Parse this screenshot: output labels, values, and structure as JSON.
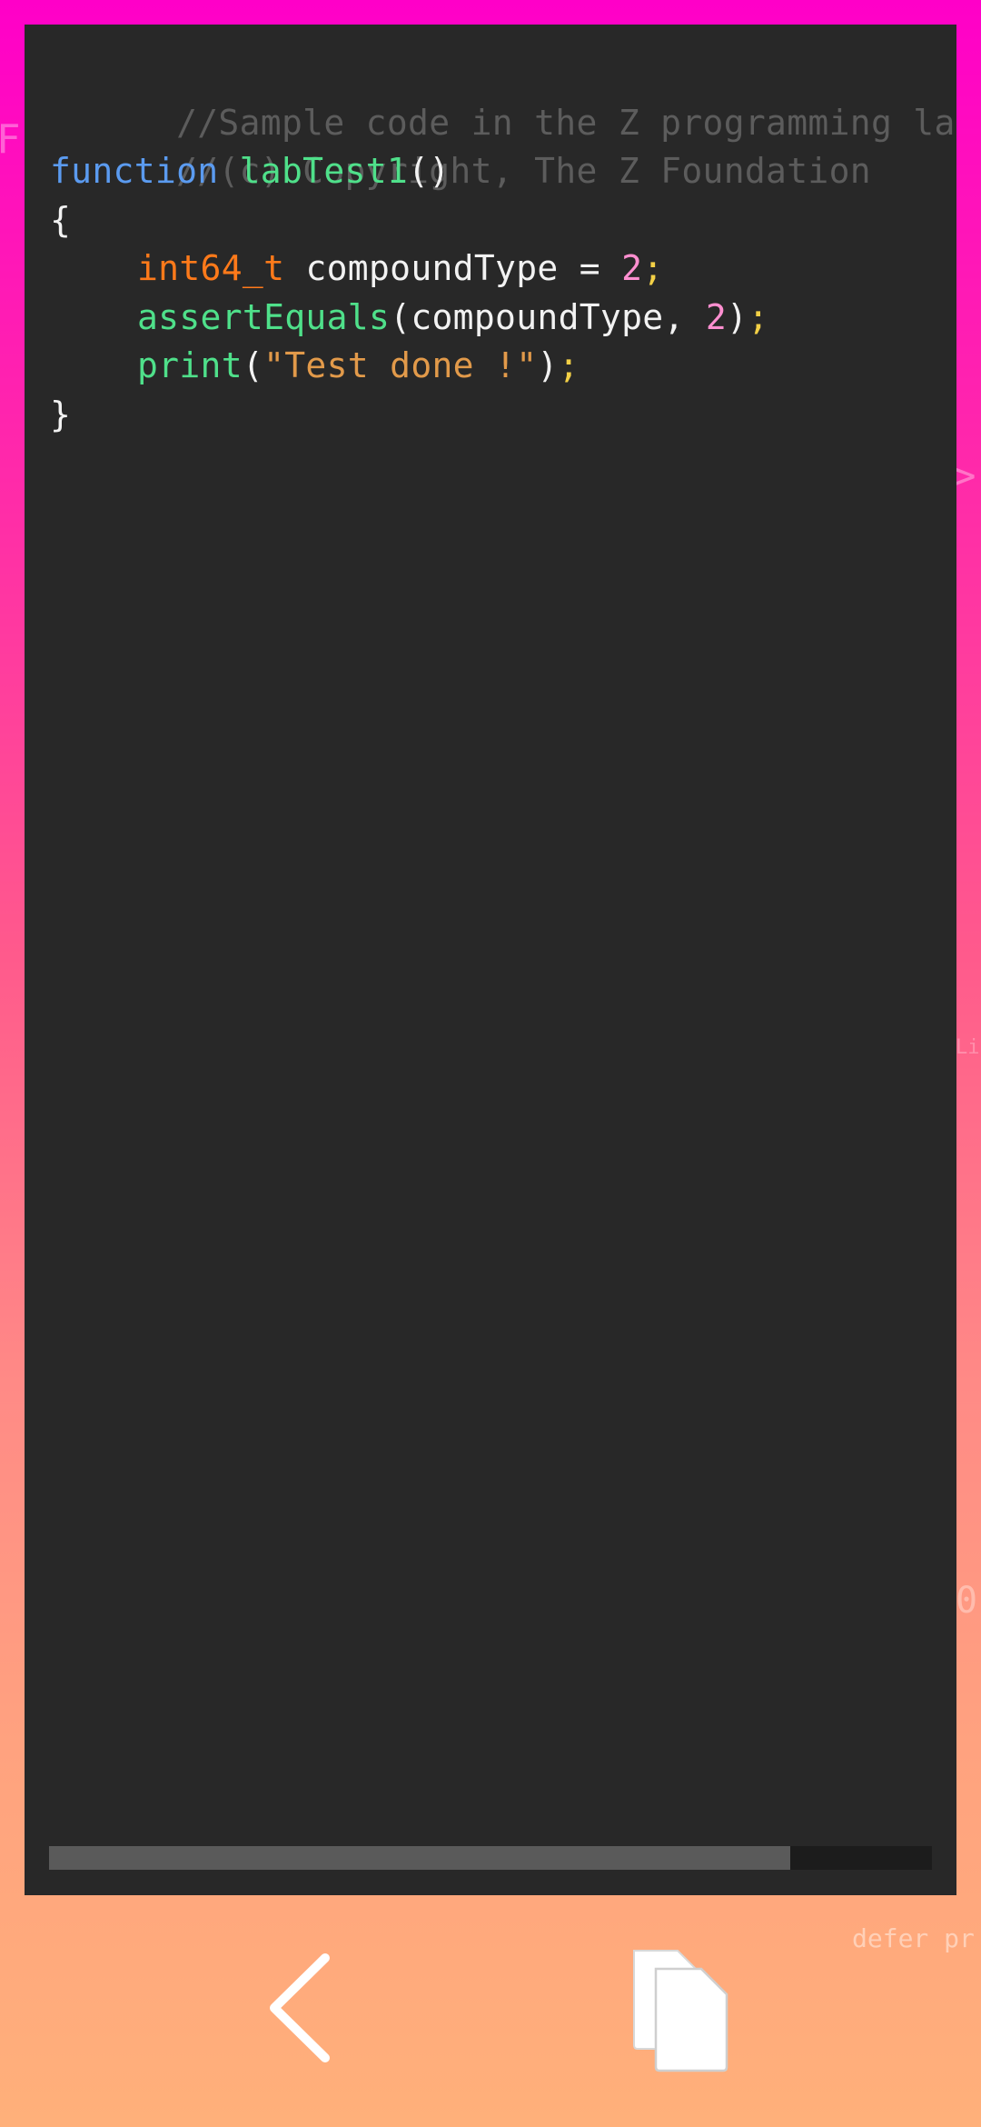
{
  "background_text": {
    "left_letter": "F",
    "right_chevron": ">",
    "right_small": "Li",
    "right_digit": "0",
    "bottom_right": "defer pr"
  },
  "code": {
    "line1": "//Sample code in the Z programming langu",
    "line2": "//(c) Copyright, The Z Foundation",
    "line3_keyword": "function",
    "line3_name": "labTest1",
    "line3_parens": "()",
    "line4": "{",
    "line5_type": "int64_t",
    "line5_var": "compoundType =",
    "line5_num": "2",
    "line5_semi": ";",
    "line6_fn": "assertEquals",
    "line6_args_open": "(compoundType,",
    "line6_num": "2",
    "line6_close": ")",
    "line6_semi": ";",
    "line7_fn": "print",
    "line7_open": "(",
    "line7_str": "\"Test done !\"",
    "line7_close": ")",
    "line7_semi": ";",
    "line8": "}"
  },
  "scrollbar": {
    "position_fraction": 0.84
  },
  "icons": {
    "back": "chevron-left-icon",
    "copy": "copy-icon"
  },
  "colors": {
    "editor_background": "#282828",
    "comment": "#5c5c5c",
    "keyword": "#5b9bf0",
    "function": "#4fe08a",
    "type": "#ff7a1a",
    "number": "#ff8fd0",
    "string": "#e29a4a",
    "semicolon": "#f3d046"
  }
}
